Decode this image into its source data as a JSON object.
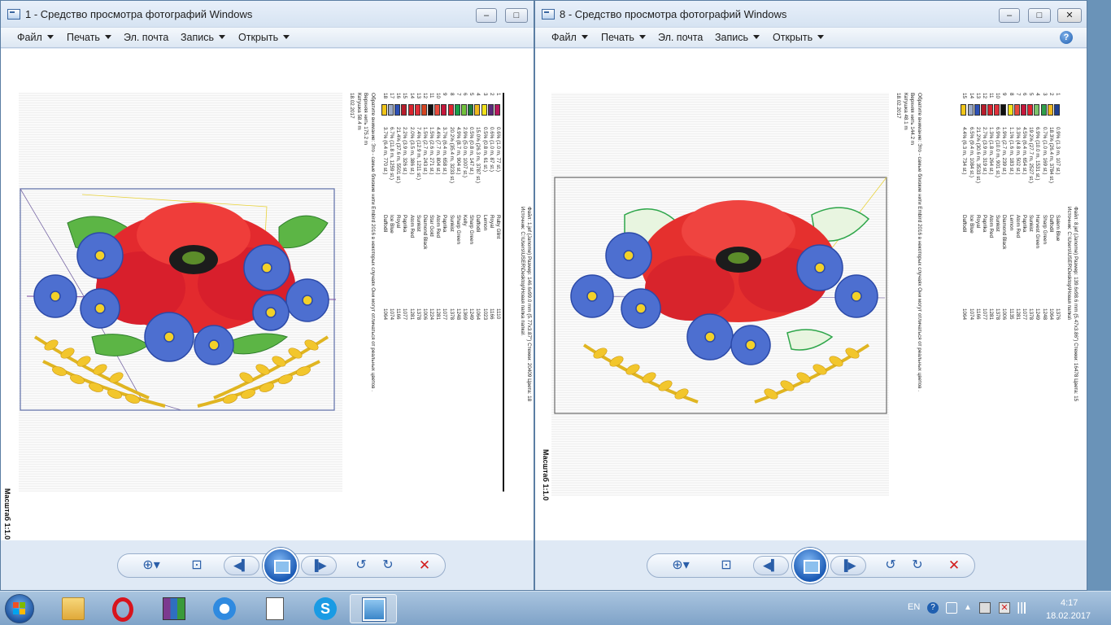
{
  "windows": [
    {
      "title": "1 - Средство просмотра фотографий Windows",
      "menu": {
        "file": "Файл",
        "print": "Печать",
        "email": "Эл. почта",
        "burn": "Запись",
        "open": "Открыть"
      },
      "report": {
        "date": "18.02.2017",
        "headers": {
          "num": "Нить",
          "usage": "Расход",
          "name": "Имя",
          "code": "Madeira Rayon"
        },
        "rows": [
          {
            "n": "1",
            "color": "#b5165e",
            "usage": "0.6% (1.0 m, 77 st.)",
            "name": "Ruby Glint",
            "code": "1110"
          },
          {
            "n": "2",
            "color": "#5a2a7a",
            "usage": "0.6% (1.0 m, 87 st.)",
            "name": "Royal",
            "code": "1166"
          },
          {
            "n": "3",
            "color": "#f2e21a",
            "usage": "0.5% (0.8 m, 61 st.)",
            "name": "Lemon",
            "code": "1023"
          },
          {
            "n": "4",
            "color": "#f0b81d",
            "usage": "15.0% (26.3 m, 3787 st.)",
            "name": "Daffodil",
            "code": "1064"
          },
          {
            "n": "5",
            "color": "#1f7d3a",
            "usage": "0.5% (0.8 m, 147 st.)",
            "name": "Sharp Green",
            "code": "1249"
          },
          {
            "n": "6",
            "color": "#72c23b",
            "usage": "2.9% (5.0 m, 1007 st.)",
            "name": "Kelly",
            "code": "1369"
          },
          {
            "n": "7",
            "color": "#1aa04a",
            "usage": "4.9% (8.7 m, 904 st.)",
            "name": "Sharp Green",
            "code": "1248"
          },
          {
            "n": "8",
            "color": "#e22430",
            "usage": "20.2% (35.4 m, 3233 st.)",
            "name": "Sunkist",
            "code": "1378"
          },
          {
            "n": "9",
            "color": "#c6173b",
            "usage": "3.7% (6.4 m, 658 st.)",
            "name": "Paprika",
            "code": "1077"
          },
          {
            "n": "10",
            "color": "#e84a3c",
            "usage": "4.4% (7.7 m, 804 st.)",
            "name": "Atom Red",
            "code": "1281"
          },
          {
            "n": "11",
            "color": "#111111",
            "usage": "1.5% (2.6 m, 271 st.)",
            "name": "Star Gold",
            "code": "1224"
          },
          {
            "n": "12",
            "color": "#d64420",
            "usage": "1.5% (2.7 m, 243 st.)",
            "name": "Diamond Black",
            "code": "1006"
          },
          {
            "n": "13",
            "color": "#e0303a",
            "usage": "7.4% (12.9 m, 1211 st.)",
            "name": "Sunkist",
            "code": "1378"
          },
          {
            "n": "14",
            "color": "#d8242e",
            "usage": "2.0% (3.5 m, 386 st.)",
            "name": "Atom Red",
            "code": "1281"
          },
          {
            "n": "15",
            "color": "#b81c2b",
            "usage": "2.2% (3.9 m, 326 st.)",
            "name": "Paprika",
            "code": "1077"
          },
          {
            "n": "16",
            "color": "#2b4fb5",
            "usage": "21.4% (37.6 m, 5501 st.)",
            "name": "Royal",
            "code": "1166"
          },
          {
            "n": "17",
            "color": "#9aa8c5",
            "usage": "6.7% (11.8 m, 1259 st.)",
            "name": "Ice Blue",
            "code": "1074"
          },
          {
            "n": "18",
            "color": "#f1c519",
            "usage": "3.7% (6.4 m, 770 st.)",
            "name": "Daffodil",
            "code": "1064"
          }
        ],
        "total_label": "Верхняя нить",
        "total_value": "175.2 m",
        "bobbin_label": "Катушка",
        "bobbin_value": "58.4 m",
        "note": "Обратите внимание: Это - самые близкие нити Embird 2016 в некоторых случаях Они могут отличаться от реальных цветов .",
        "source": "Источник: C:\\Users\\USER\\Desktop\\Новая папка папка\\",
        "file_info": "Файл: 1.jef (Janome)  Размер: 146.6x99.0 mm (5.77x3.87\")  Стежки: 20409  Цвета: 18  ",
        "scale": "Масштаб 1:1.0"
      }
    },
    {
      "title": "8 - Средство просмотра фотографий Windows",
      "menu": {
        "file": "Файл",
        "print": "Печать",
        "email": "Эл. почта",
        "burn": "Запись",
        "open": "Открыть"
      },
      "report": {
        "date": "18.02.2017",
        "headers": {
          "num": "Нить",
          "usage": "Расход",
          "name": "Имя",
          "code": "Madeira Rayon"
        },
        "rows": [
          {
            "n": "1",
            "color": "#1f3f8f",
            "usage": "0.9% (1.3 m, 107 st.)",
            "name": "Salem Blue",
            "code": "1376"
          },
          {
            "n": "2",
            "color": "#f0b81d",
            "usage": "18.3% (26.4 m, 3784 st.)",
            "name": "Daffodil",
            "code": "1064"
          },
          {
            "n": "3",
            "color": "#2e9f4a",
            "usage": "0.7% (1.0 m, 169 st.)",
            "name": "Sharp Green",
            "code": "1248"
          },
          {
            "n": "4",
            "color": "#7cc46a",
            "usage": "6.9% (10.0 m, 1531 st.)",
            "name": "Harvest Green",
            "code": "1249"
          },
          {
            "n": "5",
            "color": "#e22430",
            "usage": "19.2% (27.7 m, 2527 st.)",
            "name": "Sunkist",
            "code": "1378"
          },
          {
            "n": "6",
            "color": "#c6173b",
            "usage": "4.5% (6.4 m, 654 st.)",
            "name": "Paprika",
            "code": "1077"
          },
          {
            "n": "7",
            "color": "#e84a3c",
            "usage": "3.3% (4.8 m, 502 st.)",
            "name": "Atom Red",
            "code": "1281"
          },
          {
            "n": "8",
            "color": "#f2e21a",
            "usage": "1.1% (1.6 m, 183 st.)",
            "name": "Lemon",
            "code": "1135"
          },
          {
            "n": "9",
            "color": "#111111",
            "usage": "1.9% (2.7 m, 239 st.)",
            "name": "Diamond Black",
            "code": "1006"
          },
          {
            "n": "10",
            "color": "#e0303a",
            "usage": "6.9% (10.0 m, 901 st.)",
            "name": "Sunkist",
            "code": "1378"
          },
          {
            "n": "11",
            "color": "#d8242e",
            "usage": "1.3% (1.8 m, 264 st.)",
            "name": "Atom Red",
            "code": "1281"
          },
          {
            "n": "12",
            "color": "#b81c2b",
            "usage": "2.7% (3.9 m, 319 st.)",
            "name": "Paprika",
            "code": "1077"
          },
          {
            "n": "13",
            "color": "#2b4fb5",
            "usage": "21.2% (30.6 m, 3533 st.)",
            "name": "Royal",
            "code": "1166"
          },
          {
            "n": "14",
            "color": "#9aa8c5",
            "usage": "6.5% (9.4 m, 1084 st.)",
            "name": "Ice Blue",
            "code": "1074"
          },
          {
            "n": "15",
            "color": "#f1c519",
            "usage": "4.4% (6.3 m, 734 st.)",
            "name": "Daffodil",
            "code": "1064"
          }
        ],
        "total_label": "Верхняя нить",
        "total_value": "144.2 m",
        "bobbin_label": "Катушка",
        "bobbin_value": "48.1 m",
        "note": "Обратите внимание: Это - самые близкие нити Embird 2016 в некоторых случаях Они могут отличаться от реальных цветов .",
        "source": "Источник: C:\\Users\\USER\\Desktop\\Новая папка\\",
        "file_info": "Файл: 8.jef (Janome)  Размер: 139.6x98.6 mm (5.47x3.86\")  Стежки: 16478  Цвета: 15  ",
        "scale": "Масштаб 1:1.0"
      }
    }
  ],
  "taskbar": {
    "apps": [
      "explorer",
      "opera",
      "winrar",
      "internet-explorer",
      "notepad",
      "skype",
      "photo-viewer"
    ],
    "language": "EN",
    "time": "4:17",
    "date": "18.02.2017"
  },
  "colors": {
    "window_frame": "#dfe9f5",
    "titlebar_text": "#1e1e1e",
    "taskbar": "#8fb0d2",
    "delete_red": "#d21d1d"
  }
}
